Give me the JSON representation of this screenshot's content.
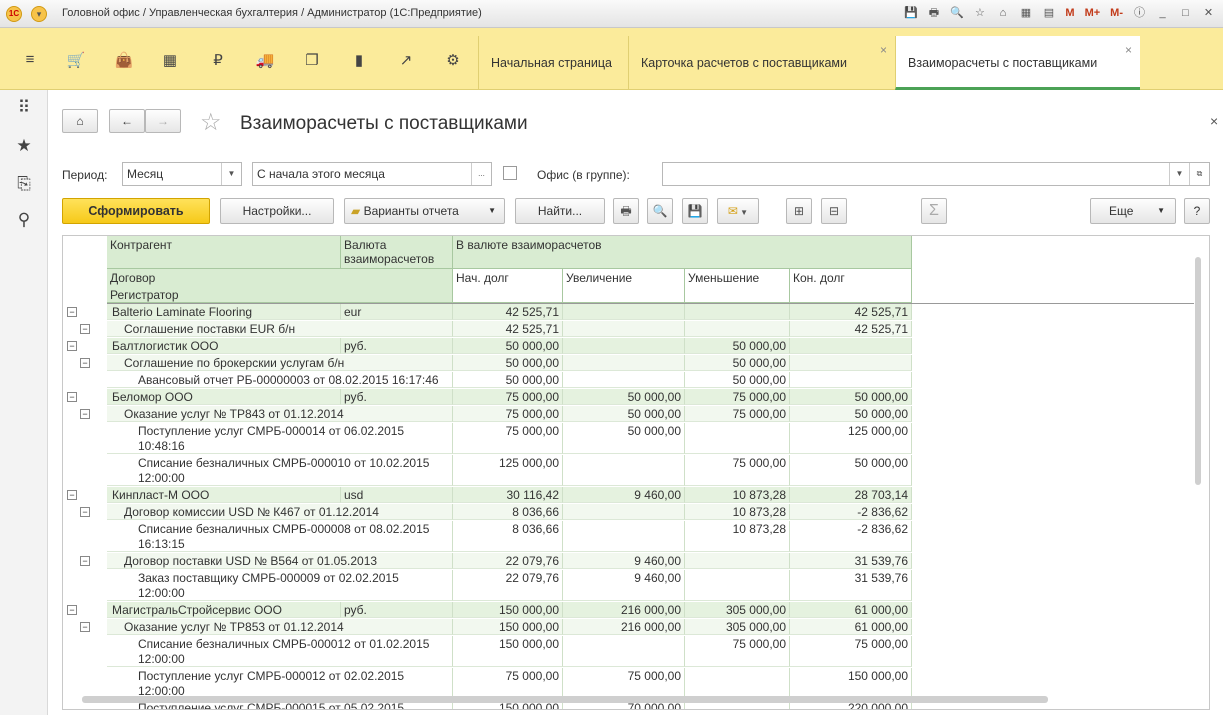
{
  "window": {
    "title": "Головной офис / Управленческая бухгалтерия / Администратор  (1С:Предприятие)",
    "logo": "1С"
  },
  "titlebar_tools": {
    "m": "M",
    "mplus": "M+",
    "mminus": "M-"
  },
  "tabs": [
    {
      "label": "Начальная страница"
    },
    {
      "label": "Карточка расчетов с поставщиками"
    },
    {
      "label": "Взаиморасчеты с поставщиками"
    }
  ],
  "form": {
    "title": "Взаиморасчеты с поставщиками",
    "period_label": "Период:",
    "period_value": "Месяц",
    "period_range": "С начала этого месяца",
    "office_label": "Офис (в группе):",
    "office_value": ""
  },
  "toolbar": {
    "generate": "Сформировать",
    "settings": "Настройки...",
    "variants": "Варианты отчета",
    "find": "Найти...",
    "more": "Еще",
    "help": "?",
    "sigma": "Σ"
  },
  "table": {
    "headers": {
      "counterparty": "Контрагент",
      "currency": "Валюта взаиморасчетов",
      "in_currency": "В валюте взаиморасчетов",
      "contract": "Договор",
      "registrar": "Регистратор",
      "start": "Нач. долг",
      "increase": "Увеличение",
      "decrease": "Уменьшение",
      "end": "Кон. долг"
    },
    "rows": [
      {
        "level": 1,
        "name": "Balterio Laminate Flooring",
        "cur": "eur",
        "start": "42 525,71",
        "inc": "",
        "dec": "",
        "end": "42 525,71"
      },
      {
        "level": 2,
        "name": "Соглашение поставки EUR б/н",
        "cur": "",
        "start": "42 525,71",
        "inc": "",
        "dec": "",
        "end": "42 525,71"
      },
      {
        "level": 1,
        "name": "Балтлогистик ООО",
        "cur": "руб.",
        "start": "50 000,00",
        "inc": "",
        "dec": "50 000,00",
        "end": ""
      },
      {
        "level": 2,
        "name": "Соглашение по брокерскии услугам б/н",
        "cur": "",
        "start": "50 000,00",
        "inc": "",
        "dec": "50 000,00",
        "end": ""
      },
      {
        "level": 3,
        "name": "Авансовый отчет РБ-00000003 от 08.02.2015 16:17:46",
        "cur": "",
        "start": "50 000,00",
        "inc": "",
        "dec": "50 000,00",
        "end": ""
      },
      {
        "level": 1,
        "name": "Беломор ООО",
        "cur": "руб.",
        "start": "75 000,00",
        "inc": "50 000,00",
        "dec": "75 000,00",
        "end": "50 000,00"
      },
      {
        "level": 2,
        "name": "Оказание услуг № ТР843 от 01.12.2014",
        "cur": "",
        "start": "75 000,00",
        "inc": "50 000,00",
        "dec": "75 000,00",
        "end": "50 000,00"
      },
      {
        "level": 3,
        "name": "Поступление услуг СМРБ-000014 от 06.02.2015",
        "name2": "10:48:16",
        "cur": "",
        "start": "75 000,00",
        "inc": "50 000,00",
        "dec": "",
        "end": "125 000,00"
      },
      {
        "level": 3,
        "name": "Списание безналичных СМРБ-000010 от 10.02.2015",
        "name2": "12:00:00",
        "cur": "",
        "start": "125 000,00",
        "inc": "",
        "dec": "75 000,00",
        "end": "50 000,00"
      },
      {
        "level": 1,
        "name": "Кинпласт-М ООО",
        "cur": "usd",
        "start": "30 116,42",
        "inc": "9 460,00",
        "dec": "10 873,28",
        "end": "28 703,14"
      },
      {
        "level": 2,
        "name": "Договор комиссии USD № К467 от 01.12.2014",
        "cur": "",
        "start": "8 036,66",
        "inc": "",
        "dec": "10 873,28",
        "end": "-2 836,62"
      },
      {
        "level": 3,
        "name": "Списание безналичных СМРБ-000008 от 08.02.2015",
        "name2": "16:13:15",
        "cur": "",
        "start": "8 036,66",
        "inc": "",
        "dec": "10 873,28",
        "end": "-2 836,62"
      },
      {
        "level": 2,
        "name": "Договор поставки USD № В564 от 01.05.2013",
        "cur": "",
        "start": "22 079,76",
        "inc": "9 460,00",
        "dec": "",
        "end": "31 539,76"
      },
      {
        "level": 3,
        "name": "Заказ поставщику СМРБ-000009 от 02.02.2015",
        "name2": "12:00:00",
        "cur": "",
        "start": "22 079,76",
        "inc": "9 460,00",
        "dec": "",
        "end": "31 539,76"
      },
      {
        "level": 1,
        "name": "МагистральСтройсервис ООО",
        "cur": "руб.",
        "start": "150 000,00",
        "inc": "216 000,00",
        "dec": "305 000,00",
        "end": "61 000,00"
      },
      {
        "level": 2,
        "name": "Оказание услуг № ТР853 от 01.12.2014",
        "cur": "",
        "start": "150 000,00",
        "inc": "216 000,00",
        "dec": "305 000,00",
        "end": "61 000,00"
      },
      {
        "level": 3,
        "name": "Списание безналичных СМРБ-000012 от 01.02.2015",
        "name2": "12:00:00",
        "cur": "",
        "start": "150 000,00",
        "inc": "",
        "dec": "75 000,00",
        "end": "75 000,00"
      },
      {
        "level": 3,
        "name": "Поступление услуг СМРБ-000012 от 02.02.2015",
        "name2": "12:00:00",
        "cur": "",
        "start": "75 000,00",
        "inc": "75 000,00",
        "dec": "",
        "end": "150 000,00"
      },
      {
        "level": 3,
        "name": "Поступление услуг СМРБ-000015 от 05.02.2015",
        "cur": "",
        "start": "150 000,00",
        "inc": "70 000,00",
        "dec": "",
        "end": "220 000,00"
      }
    ]
  }
}
